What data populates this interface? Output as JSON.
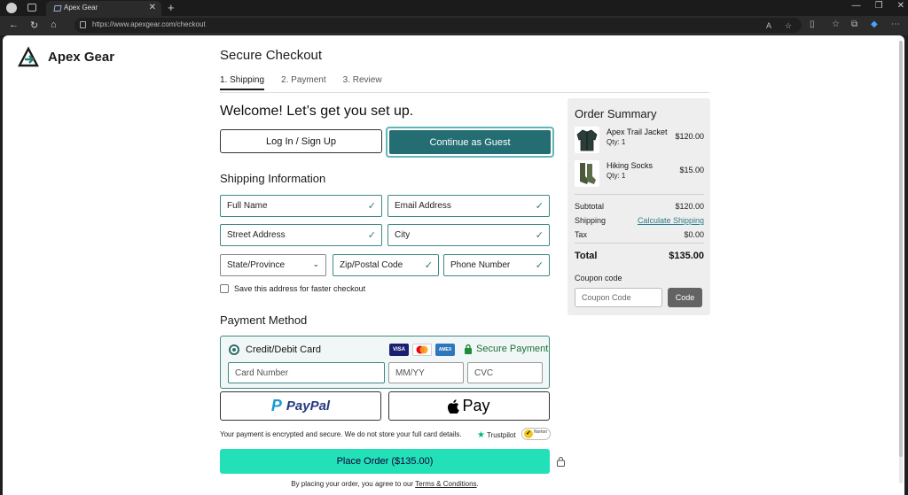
{
  "browser": {
    "tab_title": "Apex Gear",
    "url": "https://www.apexgear.com/checkout"
  },
  "brand": {
    "name": "Apex Gear"
  },
  "checkout": {
    "title": "Secure Checkout",
    "steps": [
      {
        "label": "1. Shipping",
        "active": true
      },
      {
        "label": "2. Payment",
        "active": false
      },
      {
        "label": "3. Review",
        "active": false
      }
    ],
    "welcome": "Welcome! Let’s get you set up.",
    "login_button": "Log In / Sign Up",
    "guest_button": "Continue as Guest",
    "shipping": {
      "heading": "Shipping Information",
      "fields": {
        "full_name": "Full Name",
        "email": "Email Address",
        "street": "Street Address",
        "city": "City",
        "state": "State/Province",
        "zip": "Zip/Postal Code",
        "phone": "Phone Number"
      },
      "save_address_label": "Save this address for faster checkout"
    },
    "payment": {
      "heading": "Payment Method",
      "card_option": "Credit/Debit Card",
      "card_brands": [
        "VISA",
        "Mastercard",
        "AMEX"
      ],
      "secure_label": "Secure Payment",
      "card_number_placeholder": "Card Number",
      "expiry_placeholder": "MM/YY",
      "cvc_placeholder": "CVC",
      "paypal_label": "PayPal",
      "applepay_label": "Pay",
      "security_note": "Your payment is encrypted and secure. We do not store your full card details.",
      "trustpilot": "Trustpilot",
      "norton": "Norton"
    },
    "place_order": "Place Order ($135.00)",
    "terms_prefix": "By placing your order, you agree to our ",
    "terms_link": "Terms & Conditions",
    "terms_suffix": "."
  },
  "summary": {
    "title": "Order Summary",
    "items": [
      {
        "name": "Apex Trail Jacket",
        "qty": "Qty: 1",
        "price": "$120.00"
      },
      {
        "name": "Hiking Socks",
        "qty": "Qty: 1",
        "price": "$15.00"
      }
    ],
    "subtotal_label": "Subtotal",
    "subtotal": "$120.00",
    "shipping_label": "Shipping",
    "shipping_link": "Calculate Shipping",
    "tax_label": "Tax",
    "tax": "$0.00",
    "total_label": "Total",
    "total": "$135.00",
    "coupon_label": "Coupon code",
    "coupon_placeholder": "Coupon Code",
    "coupon_button": "Code"
  },
  "colors": {
    "teal_dark": "#246e73",
    "teal_border": "#3c8a85",
    "place_order_green": "#22e0b8"
  }
}
